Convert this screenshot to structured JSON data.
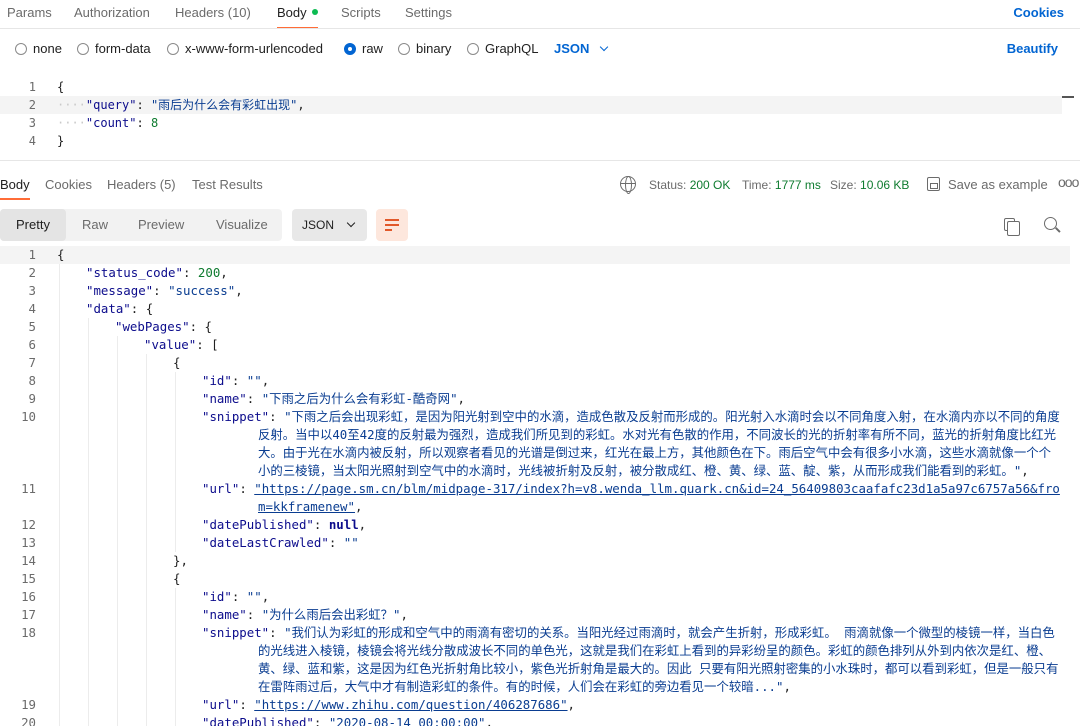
{
  "request_tabs": [
    "Params",
    "Authorization",
    "Headers (10)",
    "Body",
    "Scripts",
    "Settings"
  ],
  "cookies_label": "Cookies",
  "body_types": [
    "none",
    "form-data",
    "x-www-form-urlencoded",
    "raw",
    "binary",
    "GraphQL"
  ],
  "body_type_selected": "raw",
  "body_format": "JSON",
  "beautify_label": "Beautify",
  "request_lines": [
    {
      "n": "1",
      "text": "{"
    },
    {
      "n": "2",
      "key": "\"query\"",
      "val": "\"雨后为什么会有彩虹出现\""
    },
    {
      "n": "3",
      "key": "\"count\"",
      "val": "8"
    },
    {
      "n": "4",
      "text": "}"
    }
  ],
  "response_tabs": [
    "Body",
    "Cookies",
    "Headers (5)",
    "Test Results"
  ],
  "status": {
    "label": "Status:",
    "value": "200 OK",
    "time_label": "Time:",
    "time": "1777 ms",
    "size_label": "Size:",
    "size": "10.06 KB"
  },
  "save_example_label": "Save as example",
  "more_label": "ooo",
  "view_modes": [
    "Pretty",
    "Raw",
    "Preview",
    "Visualize"
  ],
  "response_format": "JSON",
  "response_lines": [
    {
      "n": "1",
      "t": "{"
    },
    {
      "n": "2",
      "k": "\"status_code\"",
      "v": "200",
      "vt": "num",
      "tail": ","
    },
    {
      "n": "3",
      "k": "\"message\"",
      "v": "\"success\"",
      "vt": "str",
      "tail": ","
    },
    {
      "n": "4",
      "k": "\"data\"",
      "v": "{",
      "vt": "pun"
    },
    {
      "n": "5",
      "k": "\"webPages\"",
      "v": "{",
      "vt": "pun"
    },
    {
      "n": "6",
      "k": "\"value\"",
      "v": "[",
      "vt": "pun"
    },
    {
      "n": "7",
      "t": "{"
    },
    {
      "n": "8",
      "k": "\"id\"",
      "v": "\"\"",
      "vt": "str",
      "tail": ","
    },
    {
      "n": "9",
      "k": "\"name\"",
      "v": "\"下雨之后为什么会有彩虹-酷奇网\"",
      "vt": "str",
      "tail": ","
    },
    {
      "n": "10",
      "k": "\"snippet\"",
      "v": "\"下雨之后会出现彩虹，是因为阳光射到空中的水滴，造成色散及反射而形成的。阳光射入水滴时会以不同角度入射，在水滴内亦以不同的角度反射。当中以40至42度的反射最为强烈，造成我们所见到的彩虹。水对光有色散的作用，不同波长的光的折射率有所不同，蓝光的折射角度比红光大。由于光在水滴内被反射，所以观察者看见的光谱是倒过来，红光在最上方，其他颜色在下。雨后空气中会有很多小水滴，这些水滴就像一个个小的三棱镜，当太阳光照射到空气中的水滴时，光线被折射及反射，被分散成红、橙、黄、绿、蓝、靛、紫，从而形成我们能看到的彩虹。\"",
      "vt": "str",
      "tail": ","
    },
    {
      "n": "11",
      "k": "\"url\"",
      "v": "\"https://page.sm.cn/blm/midpage-317/index?h=v8.wenda_llm.quark.cn&id=24_56409803caafafc23d1a5a97c6757a56&from=kkframenew\"",
      "vt": "url",
      "tail": ","
    },
    {
      "n": "12",
      "k": "\"datePublished\"",
      "v": "null",
      "vt": "nul",
      "tail": ","
    },
    {
      "n": "13",
      "k": "\"dateLastCrawled\"",
      "v": "\"\"",
      "vt": "str"
    },
    {
      "n": "14",
      "t": "},"
    },
    {
      "n": "15",
      "t": "{"
    },
    {
      "n": "16",
      "k": "\"id\"",
      "v": "\"\"",
      "vt": "str",
      "tail": ","
    },
    {
      "n": "17",
      "k": "\"name\"",
      "v": "\"为什么雨后会出彩虹？\"",
      "vt": "str",
      "tail": ","
    },
    {
      "n": "18",
      "k": "\"snippet\"",
      "v": "\"我们认为彩虹的形成和空气中的雨滴有密切的关系。当阳光经过雨滴时，就会产生折射，形成彩虹。 雨滴就像一个微型的棱镜一样，当白色的光线进入棱镜，棱镜会将光线分散成波长不同的单色光，这就是我们在彩虹上看到的异彩纷呈的颜色。彩虹的颜色排列从外到内依次是红、橙、黄、绿、蓝和紫，这是因为红色光折射角比较小，紫色光折射角是最大的。因此 只要有阳光照射密集的小水珠时，都可以看到彩虹，但是一般只有在雷阵雨过后，大气中才有制造彩虹的条件。有的时候，人们会在彩虹的旁边看见一个较暗...\"",
      "vt": "str",
      "tail": ","
    },
    {
      "n": "19",
      "k": "\"url\"",
      "v": "\"https://www.zhihu.com/question/406287686\"",
      "vt": "url",
      "tail": ","
    },
    {
      "n": "20",
      "k": "\"datePublished\"",
      "v": "\"2020-08-14 00:00:00\"",
      "vt": "str",
      "tail": ","
    }
  ]
}
